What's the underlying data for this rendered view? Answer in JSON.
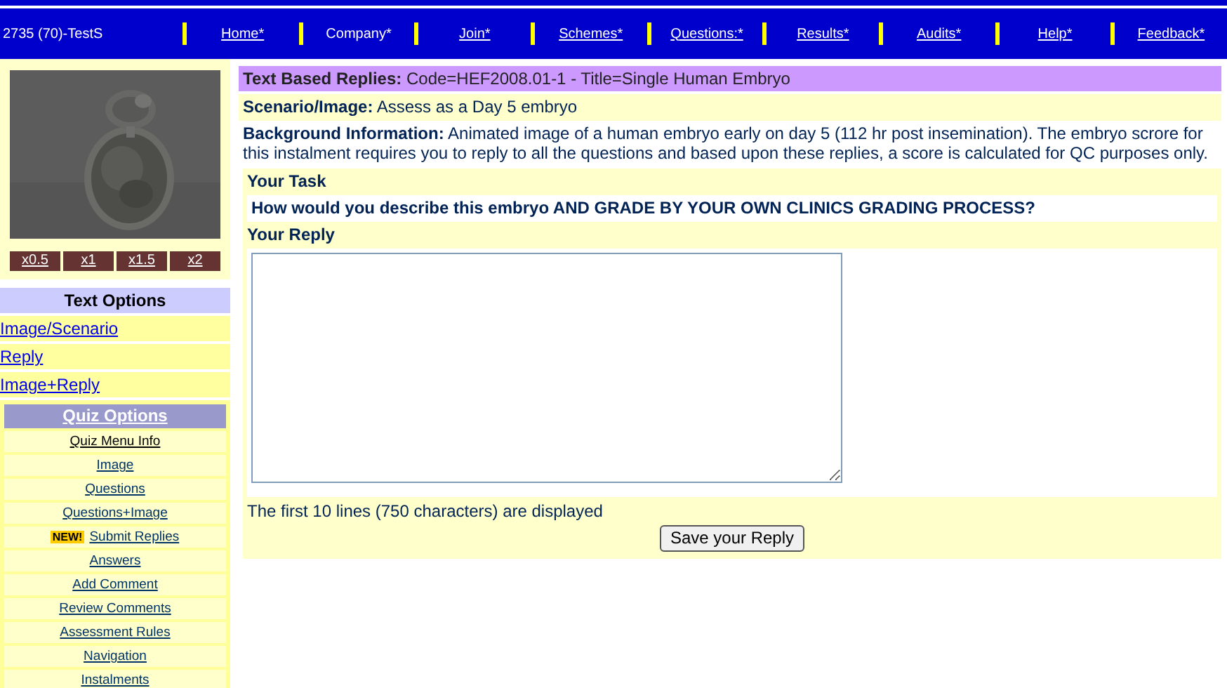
{
  "header": {
    "user": "2735 (70)-TestS",
    "nav": [
      {
        "label": "Home*",
        "link": true
      },
      {
        "label": "Company*",
        "link": false
      },
      {
        "label": "Join*",
        "link": true
      },
      {
        "label": "Schemes*",
        "link": true
      },
      {
        "label": "Questions:*",
        "link": true
      },
      {
        "label": "Results*",
        "link": true
      },
      {
        "label": "Audits*",
        "link": true
      },
      {
        "label": "Help*",
        "link": true
      },
      {
        "label": "Feedback*",
        "link": true
      }
    ]
  },
  "sidebar": {
    "zoom_buttons": [
      "x0.5",
      "x1",
      "x1.5",
      "x2"
    ],
    "text_options": {
      "title": "Text Options",
      "items": [
        "Image/Scenario",
        "Reply",
        "Image+Reply"
      ]
    },
    "quiz_options": {
      "title": "Quiz Options",
      "items": [
        {
          "label": "Quiz Menu Info",
          "selected": true
        },
        {
          "label": "Image",
          "selected": false
        },
        {
          "label": "Questions",
          "selected": false
        },
        {
          "label": "Questions+Image",
          "selected": false
        },
        {
          "label": "Submit Replies",
          "selected": false,
          "badge": "NEW!"
        },
        {
          "label": "Answers",
          "selected": false
        },
        {
          "label": "Add Comment",
          "selected": false
        },
        {
          "label": "Review Comments",
          "selected": false
        },
        {
          "label": "Assessment Rules",
          "selected": false
        },
        {
          "label": "Navigation",
          "selected": false
        },
        {
          "label": "Instalments",
          "selected": false
        }
      ]
    }
  },
  "main": {
    "title": "**Text Based Replies:** Code=HEF2008.01-1 - Title=Single Human Embryo",
    "scenario": "**Scenario/Image:** Assess as a Day 5 embryo",
    "background": "**Background Information:** Animated image of a human embryo early on day 5 (112 hr post insemination). The embryo scrore for this instalment requires you to reply to all the questions and based upon these replies, a score is calculated for QC purposes only.",
    "task_heading": "Your Task",
    "question": "How would you describe this embryo AND GRADE BY YOUR OWN CLINICS GRADING PROCESS?",
    "reply_heading": "Your Reply",
    "note": "The first 10 lines (750 characters) are displayed",
    "save_button": "Save your Reply"
  }
}
